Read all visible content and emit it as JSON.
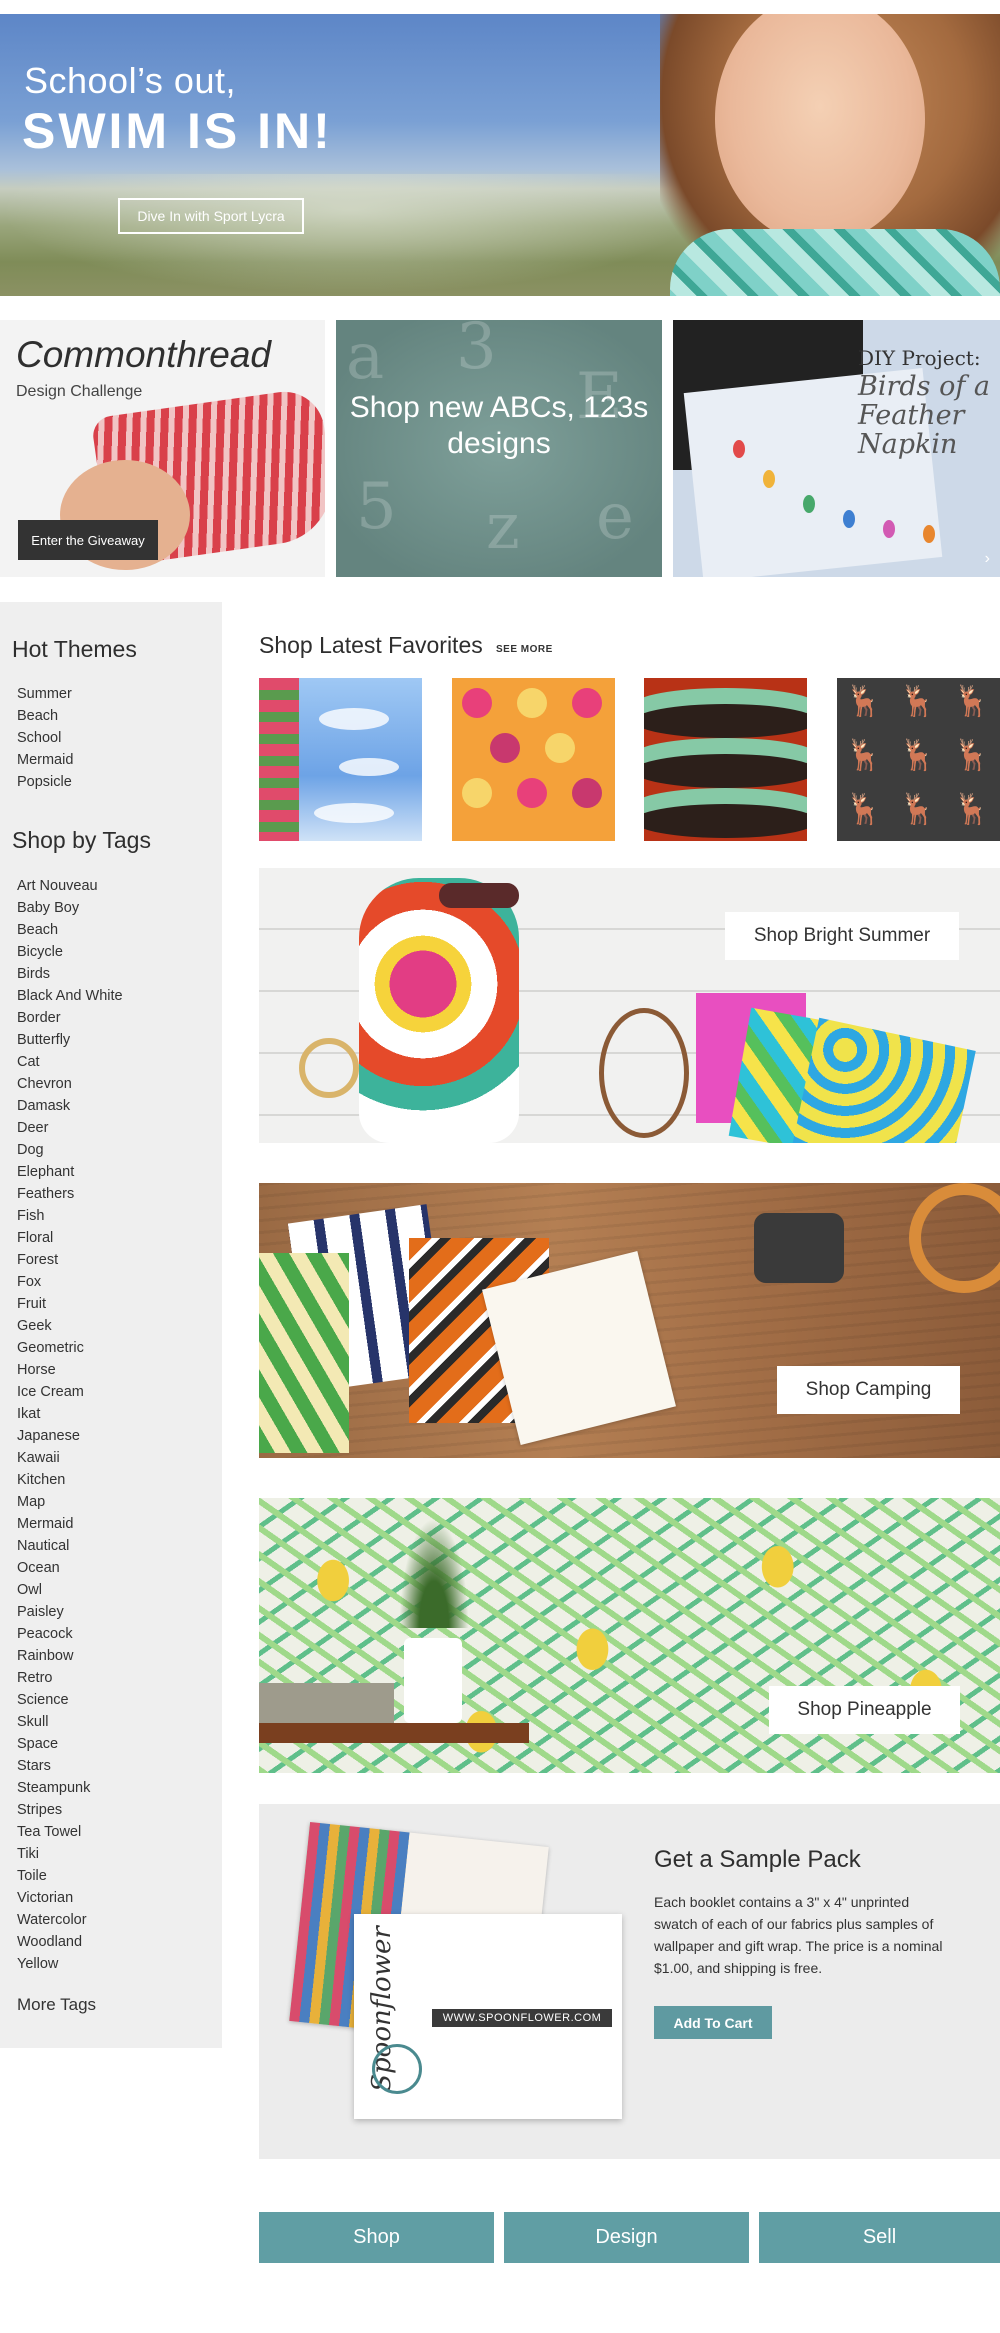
{
  "hero": {
    "line1": "School’s out,",
    "line2": "SWIM IS IN!",
    "button": "Dive In with Sport Lycra"
  },
  "promos": {
    "challenge": {
      "title": "Commonthread",
      "subtitle": "Design Challenge",
      "button": "Enter the Giveaway"
    },
    "abc": {
      "text": "Shop new ABCs, 123s designs"
    },
    "diy": {
      "heading": "DIY Project:",
      "body": "Birds of a Feather Napkin"
    }
  },
  "sidebar": {
    "hot_themes_heading": "Hot Themes",
    "hot_themes": [
      "Summer",
      "Beach",
      "School",
      "Mermaid",
      "Popsicle"
    ],
    "tags_heading": "Shop by Tags",
    "tags": [
      "Art Nouveau",
      "Baby Boy",
      "Beach",
      "Bicycle",
      "Birds",
      "Black And White",
      "Border",
      "Butterfly",
      "Cat",
      "Chevron",
      "Damask",
      "Deer",
      "Dog",
      "Elephant",
      "Feathers",
      "Fish",
      "Floral",
      "Forest",
      "Fox",
      "Fruit",
      "Geek",
      "Geometric",
      "Horse",
      "Ice Cream",
      "Ikat",
      "Japanese",
      "Kawaii",
      "Kitchen",
      "Map",
      "Mermaid",
      "Nautical",
      "Ocean",
      "Owl",
      "Paisley",
      "Peacock",
      "Rainbow",
      "Retro",
      "Science",
      "Skull",
      "Space",
      "Stars",
      "Steampunk",
      "Stripes",
      "Tea Towel",
      "Tiki",
      "Toile",
      "Victorian",
      "Watercolor",
      "Woodland",
      "Yellow"
    ],
    "more_tags": "More Tags"
  },
  "favorites": {
    "title": "Shop Latest Favorites",
    "see_more": "SEE MORE"
  },
  "banners": {
    "summer": "Shop Bright Summer",
    "camping": "Shop Camping",
    "pineapple": "Shop Pineapple"
  },
  "sample_pack": {
    "title": "Get a Sample Pack",
    "description": "Each booklet contains a 3\" x 4\" unprinted swatch of each of our fabrics plus samples of wallpaper and gift wrap. The price is a nominal $1.00, and shipping is free.",
    "button": "Add To Cart",
    "booklet_brand": "Spoonflower",
    "booklet_url": "WWW.SPOONFLOWER.COM"
  },
  "footer_nav": [
    "Shop",
    "Design",
    "Sell"
  ],
  "colors": {
    "accent": "#609ea4",
    "sidebar_bg": "#efefef",
    "dark_button": "#333333"
  }
}
